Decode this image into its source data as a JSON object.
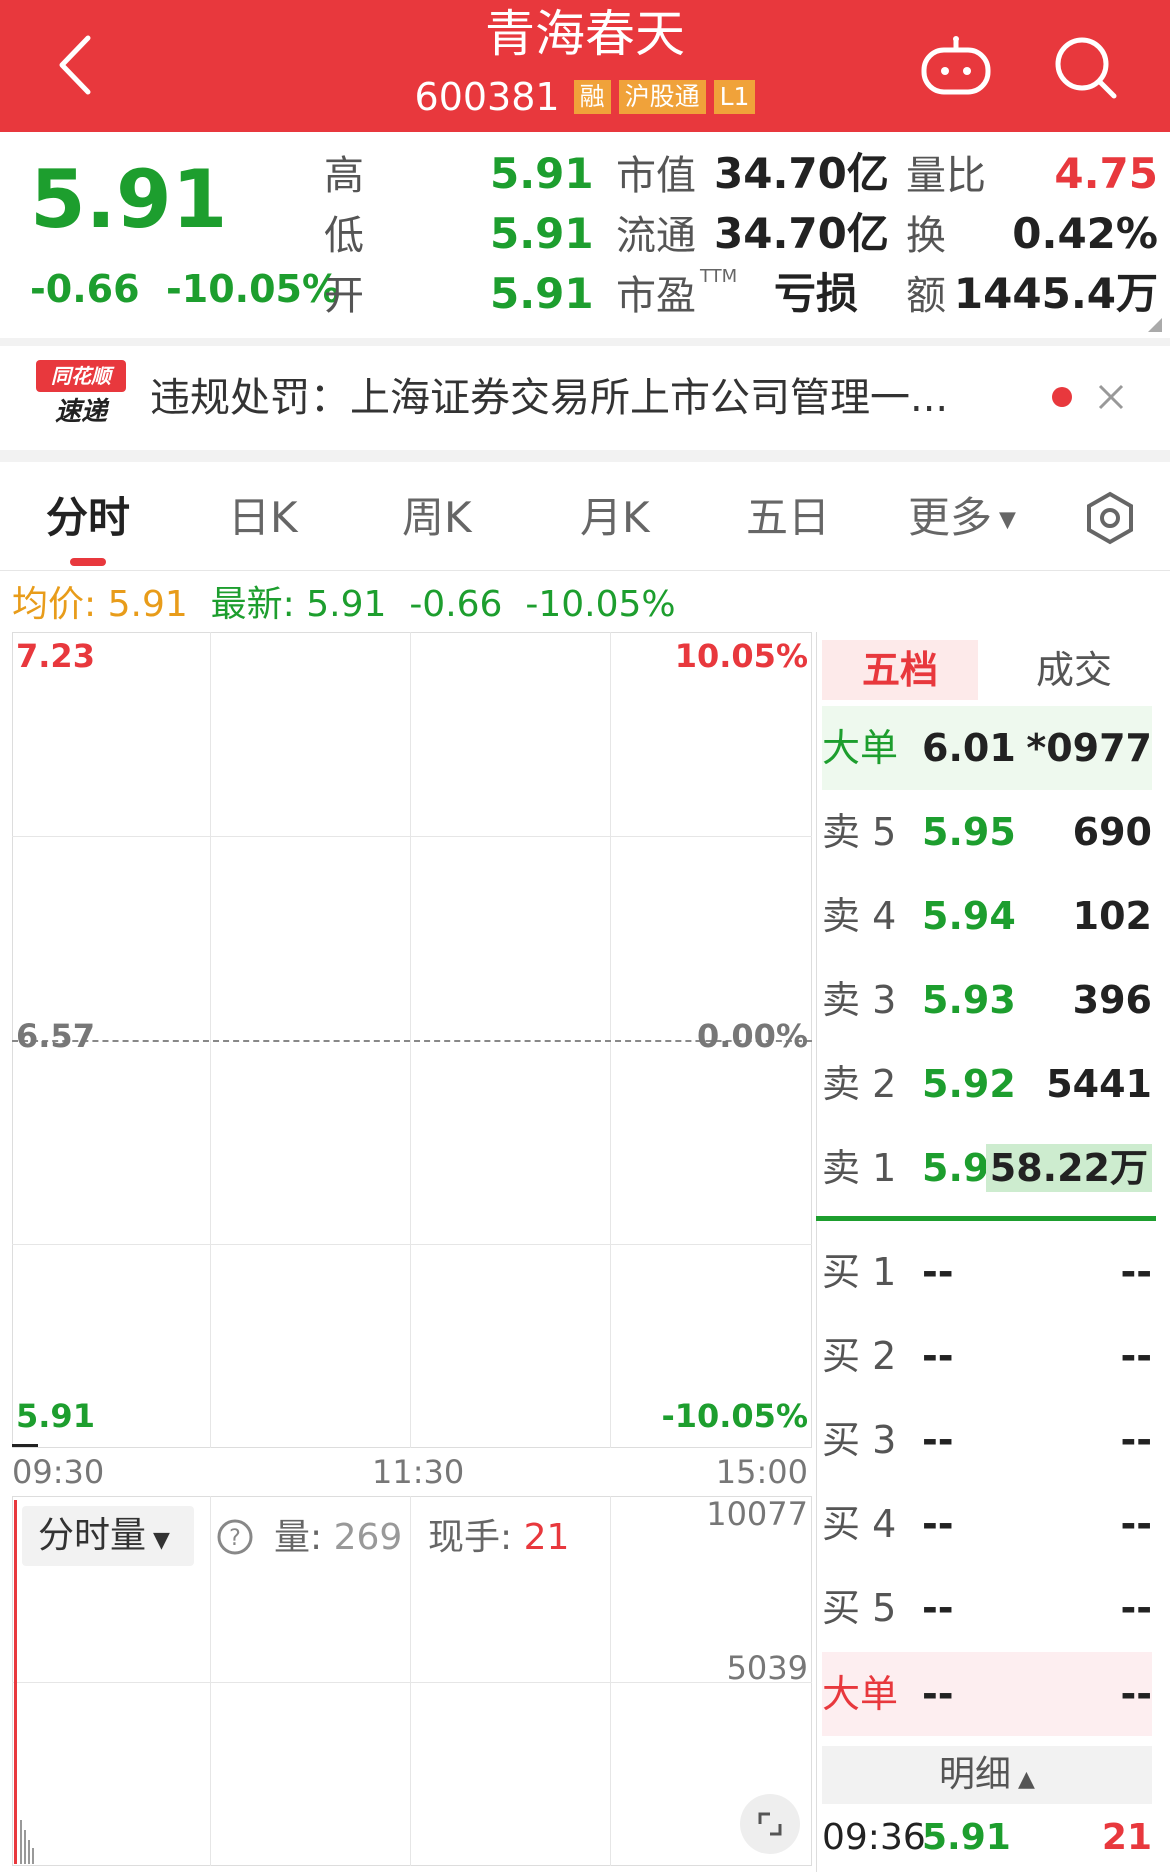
{
  "header": {
    "title": "青海春天",
    "code": "600381",
    "tags": [
      "融",
      "沪股通",
      "L1"
    ],
    "bg_color": "#e8383d"
  },
  "quote": {
    "price": "5.91",
    "change": "-0.66",
    "change_pct": "-10.05%",
    "high_label": "高",
    "high": "5.91",
    "low_label": "低",
    "low": "5.91",
    "open_label": "开",
    "open": "5.91",
    "mktcap_label": "市值",
    "mktcap": "34.70亿",
    "float_label": "流通",
    "float": "34.70亿",
    "pe_label": "市盈",
    "pe_sup": "TTM",
    "pe": "亏损",
    "volratio_label": "量比",
    "volratio": "4.75",
    "turnover_label": "换",
    "turnover": "0.42%",
    "amount_label": "额",
    "amount": "1445.4万"
  },
  "news": {
    "logo_top": "同花顺",
    "logo_bottom": "速递",
    "text": "违规处罚：上海证券交易所上市公司管理一..."
  },
  "tabs": [
    "分时",
    "日K",
    "周K",
    "月K",
    "五日",
    "更多"
  ],
  "info_line": {
    "avg_label": "均价:",
    "avg": "5.91",
    "latest_label": "最新:",
    "latest": "5.91",
    "change": "-0.66",
    "change_pct": "-10.05%"
  },
  "chart": {
    "top_price": "7.23",
    "top_pct": "10.05%",
    "mid_price": "6.57",
    "mid_pct": "0.00%",
    "bottom_price": "5.91",
    "bottom_pct": "-10.05%",
    "times": [
      "09:30",
      "11:30",
      "15:00"
    ]
  },
  "volume": {
    "dropdown": "分时量",
    "vol_label": "量:",
    "vol": "269",
    "hand_label": "现手:",
    "hand": "21",
    "top": "10077",
    "mid": "5039"
  },
  "orderbook": {
    "tabs": [
      "五档",
      "成交"
    ],
    "big_top": {
      "label": "大单",
      "price": "6.01",
      "code": "*0977"
    },
    "asks": [
      {
        "label": "卖 5",
        "price": "5.95",
        "vol": "690"
      },
      {
        "label": "卖 4",
        "price": "5.94",
        "vol": "102"
      },
      {
        "label": "卖 3",
        "price": "5.93",
        "vol": "396"
      },
      {
        "label": "卖 2",
        "price": "5.92",
        "vol": "5441"
      },
      {
        "label": "卖 1",
        "price": "5.91",
        "vol": "58.22万"
      }
    ],
    "bids": [
      {
        "label": "买 1",
        "price": "--",
        "vol": "--"
      },
      {
        "label": "买 2",
        "price": "--",
        "vol": "--"
      },
      {
        "label": "买 3",
        "price": "--",
        "vol": "--"
      },
      {
        "label": "买 4",
        "price": "--",
        "vol": "--"
      },
      {
        "label": "买 5",
        "price": "--",
        "vol": "--"
      }
    ],
    "big_bottom": {
      "label": "大单",
      "price": "--",
      "vol": "--"
    },
    "detail_label": "明细",
    "last_trade": {
      "time": "09:36",
      "price": "5.91",
      "vol": "21"
    }
  }
}
